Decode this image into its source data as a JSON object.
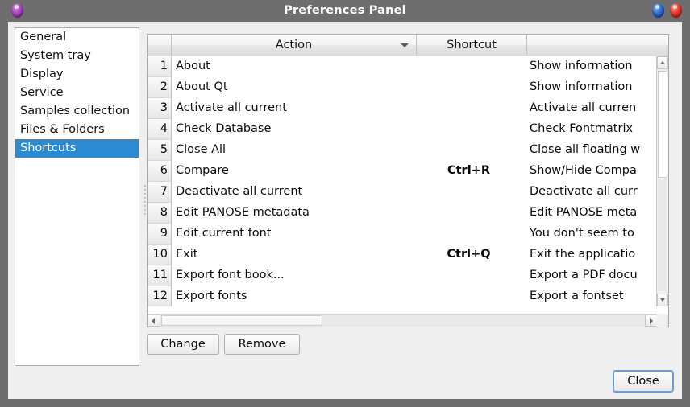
{
  "window": {
    "title": "Preferences Panel",
    "decorations": {
      "left_orb": "menu-orb",
      "minimize_orb": "minimize-orb",
      "close_orb": "close-orb"
    }
  },
  "sidebar": {
    "items": [
      {
        "label": "General",
        "selected": false
      },
      {
        "label": "System tray",
        "selected": false
      },
      {
        "label": "Display",
        "selected": false
      },
      {
        "label": "Service",
        "selected": false
      },
      {
        "label": "Samples collection",
        "selected": false
      },
      {
        "label": "Files & Folders",
        "selected": false
      },
      {
        "label": "Shortcuts",
        "selected": true
      }
    ],
    "selected_index": 6,
    "highlight_color": "#2a8bd3"
  },
  "table": {
    "headers": {
      "corner": "",
      "action": "Action",
      "shortcut": "Shortcut",
      "description": ""
    },
    "sort_column": "Action",
    "sort_direction": "descending",
    "rows": [
      {
        "num": "1",
        "action": "About",
        "shortcut": "",
        "description": "Show information"
      },
      {
        "num": "2",
        "action": "About Qt",
        "shortcut": "",
        "description": "Show information"
      },
      {
        "num": "3",
        "action": "Activate all current",
        "shortcut": "",
        "description": "Activate all curren"
      },
      {
        "num": "4",
        "action": "Check Database",
        "shortcut": "",
        "description": "Check Fontmatrix"
      },
      {
        "num": "5",
        "action": "Close All",
        "shortcut": "",
        "description": "Close all floating w"
      },
      {
        "num": "6",
        "action": "Compare",
        "shortcut": "Ctrl+R",
        "description": "Show/Hide Compa"
      },
      {
        "num": "7",
        "action": "Deactivate all current",
        "shortcut": "",
        "description": "Deactivate all curr"
      },
      {
        "num": "8",
        "action": "Edit PANOSE metadata",
        "shortcut": "",
        "description": "Edit PANOSE meta"
      },
      {
        "num": "9",
        "action": "Edit current font",
        "shortcut": "",
        "description": "You don't seem to"
      },
      {
        "num": "10",
        "action": "Exit",
        "shortcut": "Ctrl+Q",
        "description": "Exit the applicatio"
      },
      {
        "num": "11",
        "action": "Export font book...",
        "shortcut": "",
        "description": "Export a PDF docu"
      },
      {
        "num": "12",
        "action": "Export fonts",
        "shortcut": "",
        "description": "Export a fontset"
      }
    ]
  },
  "buttons": {
    "change": "Change",
    "remove": "Remove",
    "close": "Close"
  }
}
